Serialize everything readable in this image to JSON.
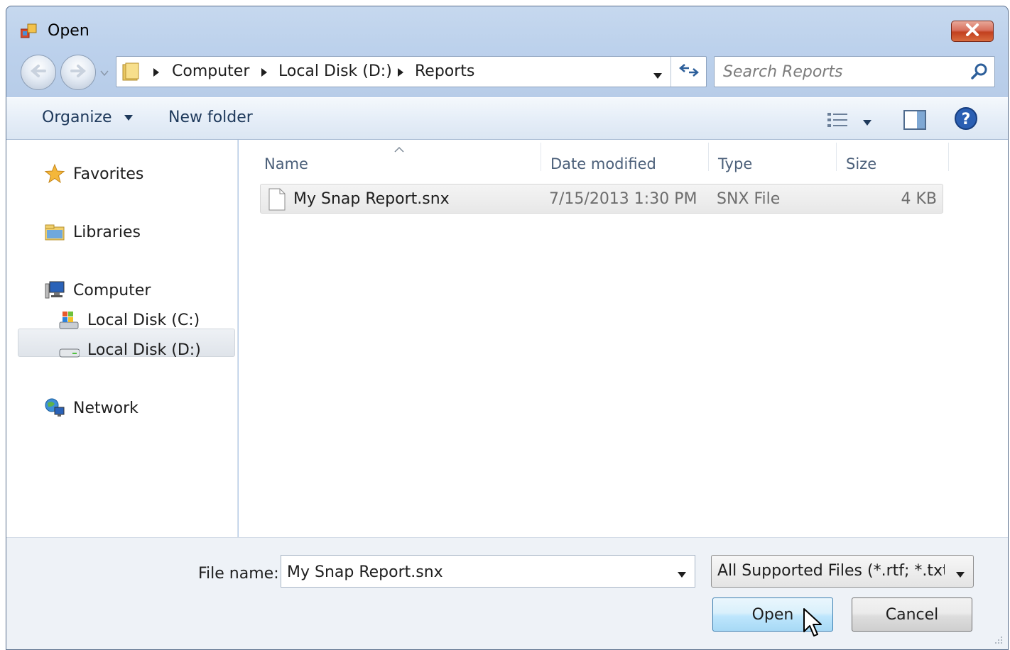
{
  "window": {
    "title": "Open"
  },
  "navigation": {
    "breadcrumbs": [
      "Computer",
      "Local Disk (D:)",
      "Reports"
    ],
    "search_placeholder": "Search Reports"
  },
  "toolbar": {
    "organize_label": "Organize",
    "new_folder_label": "New folder"
  },
  "sidebar": {
    "items": [
      {
        "label": "Favorites",
        "icon": "star-icon"
      },
      {
        "label": "Libraries",
        "icon": "libraries-icon"
      },
      {
        "label": "Computer",
        "icon": "computer-icon"
      },
      {
        "label": "Local Disk (C:)",
        "icon": "drive-c-icon"
      },
      {
        "label": "Local Disk (D:)",
        "icon": "drive-d-icon",
        "selected": true
      },
      {
        "label": "Network",
        "icon": "network-icon"
      }
    ]
  },
  "file_list": {
    "columns": [
      "Name",
      "Date modified",
      "Type",
      "Size"
    ],
    "rows": [
      {
        "name": "My Snap Report.snx",
        "date_modified": "7/15/2013 1:30 PM",
        "type": "SNX File",
        "size": "4 KB"
      }
    ]
  },
  "footer": {
    "file_name_label": "File name:",
    "file_name_value": "My Snap Report.snx",
    "filter_value": "All Supported Files (*.rtf; *.txt; *",
    "open_label": "Open",
    "cancel_label": "Cancel"
  },
  "colors": {
    "accent": "#3c7fb1",
    "close_red": "#c2401f",
    "frame": "#bcd1ec"
  }
}
